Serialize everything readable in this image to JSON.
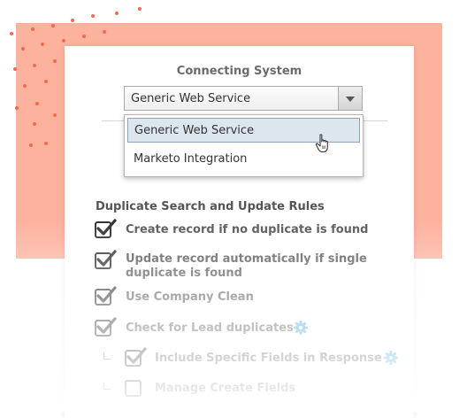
{
  "connecting_system": {
    "title": "Connecting System",
    "selected": "Generic Web Service",
    "options": [
      "Generic Web Service",
      "Marketo Integration"
    ]
  },
  "rules": {
    "heading": "Duplicate Search and Update Rules",
    "items": [
      {
        "label": "Create record if no duplicate is found",
        "checked": true
      },
      {
        "label_line1": "Update record automatically if single",
        "label_line2": "duplicate is found",
        "checked": true
      },
      {
        "label": "Use Company Clean",
        "checked": true
      },
      {
        "label": "Check for Lead duplicates",
        "checked": true,
        "icon": "gear-icon"
      },
      {
        "label": "Include Specific Fields in Response",
        "checked": true,
        "icon": "gear-icon"
      },
      {
        "label": "Manage Create Fields",
        "checked": false
      }
    ]
  },
  "colors": {
    "accent_bg": "#fdb29e",
    "dots": "#f26b4f",
    "gear": "#4aa7e0"
  }
}
